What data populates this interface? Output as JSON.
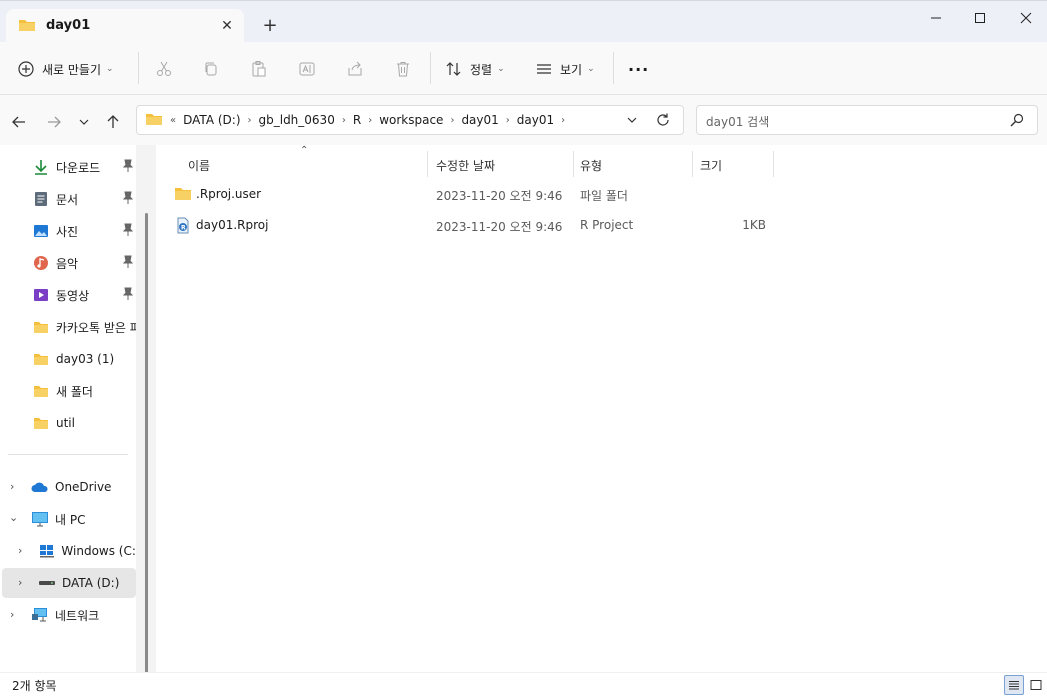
{
  "tab": {
    "title": "day01",
    "close_glyph": "✕"
  },
  "new_tab_glyph": "+",
  "toolbar": {
    "new_label": "새로 만들기",
    "sort_label": "정렬",
    "view_label": "보기",
    "more_glyph": "···"
  },
  "address": {
    "crumbs": [
      "DATA (D:)",
      "gb_ldh_0630",
      "R",
      "workspace",
      "day01",
      "day01"
    ],
    "overflow_glyph": "«"
  },
  "search": {
    "placeholder": "day01 검색"
  },
  "sidebar": {
    "quick": [
      {
        "label": "다운로드",
        "icon": "download-icon",
        "pinned": true
      },
      {
        "label": "문서",
        "icon": "document-icon",
        "pinned": true
      },
      {
        "label": "사진",
        "icon": "picture-icon",
        "pinned": true
      },
      {
        "label": "음악",
        "icon": "music-icon",
        "pinned": true
      },
      {
        "label": "동영상",
        "icon": "video-icon",
        "pinned": true
      },
      {
        "label": "카카오톡 받은 파",
        "icon": "folder-icon",
        "pinned": false
      },
      {
        "label": "day03 (1)",
        "icon": "folder-icon",
        "pinned": false
      },
      {
        "label": "새 폴더",
        "icon": "folder-icon",
        "pinned": false
      },
      {
        "label": "util",
        "icon": "folder-icon",
        "pinned": false
      }
    ],
    "tree": [
      {
        "label": "OneDrive",
        "icon": "cloud-icon"
      },
      {
        "label": "내 PC",
        "icon": "pc-icon"
      },
      {
        "label": "Windows (C:)",
        "icon": "windows-drive-icon"
      },
      {
        "label": "DATA (D:)",
        "icon": "drive-icon"
      },
      {
        "label": "네트워크",
        "icon": "network-icon"
      }
    ]
  },
  "columns": {
    "name": "이름",
    "modified": "수정한 날짜",
    "type": "유형",
    "size": "크기"
  },
  "files": [
    {
      "name": ".Rproj.user",
      "modified": "2023-11-20 오전 9:46",
      "type": "파일 폴더",
      "size": "",
      "icon": "folder-icon"
    },
    {
      "name": "day01.Rproj",
      "modified": "2023-11-20 오전 9:46",
      "type": "R Project",
      "size": "1KB",
      "icon": "rproj-icon"
    }
  ],
  "status": {
    "item_count": "2개 항목"
  },
  "colors": {
    "folder": "#f4c03e",
    "accent": "#0f6cbd"
  }
}
